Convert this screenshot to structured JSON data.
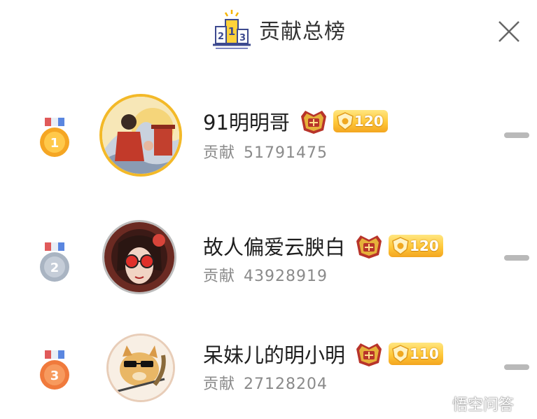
{
  "header": {
    "title": "贡献总榜",
    "podium_icon": "podium-icon",
    "close_icon": "close-icon"
  },
  "ranking": [
    {
      "rank": "1",
      "name": "91明明哥",
      "contribution_label": "贡献",
      "contribution": "51791475",
      "level": "120",
      "medal_color": "#f5a623"
    },
    {
      "rank": "2",
      "name": "故人偏爱云腴白",
      "contribution_label": "贡献",
      "contribution": "43928919",
      "level": "120",
      "medal_color": "#a9b4c2"
    },
    {
      "rank": "3",
      "name": "呆妹儿的明小明",
      "contribution_label": "贡献",
      "contribution": "27128204",
      "level": "110",
      "medal_color": "#f07a3c"
    }
  ],
  "watermark": {
    "text": "悟空问答"
  },
  "colors": {
    "gold": "#f5a623",
    "silver": "#a9b4c2",
    "bronze": "#f07a3c",
    "badge": "#ffc83a"
  }
}
